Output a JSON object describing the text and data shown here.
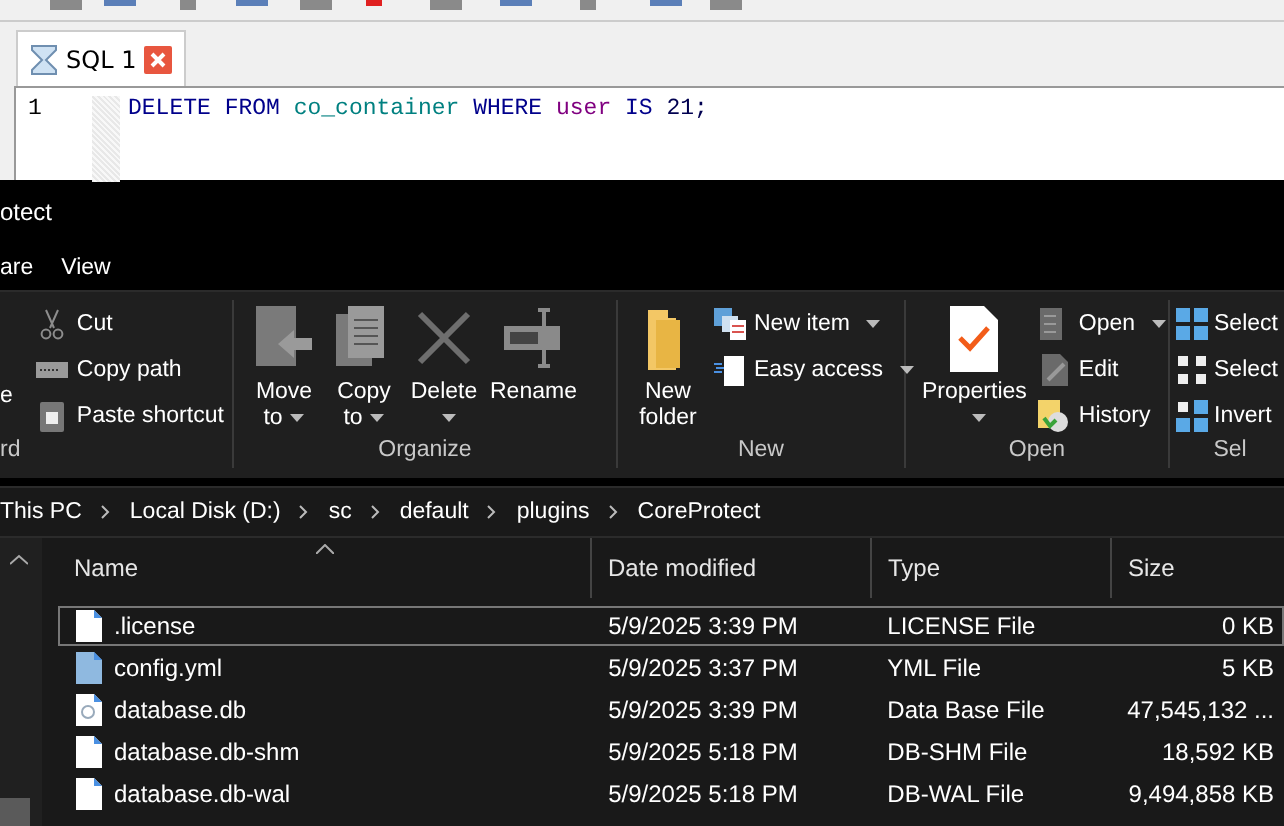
{
  "sql_editor": {
    "tab": {
      "title": "SQL 1",
      "selected": true
    },
    "lines": [
      {
        "number": "1",
        "tokens": [
          {
            "text": "DELETE",
            "kind": "keyword"
          },
          {
            "text": "FROM",
            "kind": "keyword"
          },
          {
            "text": "co_container",
            "kind": "table"
          },
          {
            "text": "WHERE",
            "kind": "keyword"
          },
          {
            "text": "user",
            "kind": "column"
          },
          {
            "text": "IS",
            "kind": "keyword"
          },
          {
            "text": "21;",
            "kind": "plain"
          }
        ]
      }
    ]
  },
  "explorer": {
    "title": "otect",
    "menu_tabs": [
      {
        "label": "are",
        "selected": false
      },
      {
        "label": "View",
        "selected": false
      }
    ],
    "ribbon": [
      {
        "label": "rd",
        "items": [
          {
            "kind": "fragment",
            "label": "e"
          },
          {
            "kind": "small",
            "label": "Cut"
          },
          {
            "kind": "small",
            "label": "Copy path"
          },
          {
            "kind": "small",
            "label": "Paste shortcut"
          }
        ]
      },
      {
        "label": "Organize",
        "items": [
          {
            "kind": "large",
            "label": "Move to",
            "dropdown": true
          },
          {
            "kind": "large",
            "label": "Copy to",
            "dropdown": true
          },
          {
            "kind": "large",
            "label": "Delete",
            "dropdown": true
          },
          {
            "kind": "large",
            "label": "Rename",
            "dropdown": false
          }
        ]
      },
      {
        "label": "New",
        "items": [
          {
            "kind": "large",
            "label": "New folder",
            "dropdown": false
          },
          {
            "kind": "small",
            "label": "New item",
            "dropdown": true
          },
          {
            "kind": "small",
            "label": "Easy access",
            "dropdown": true
          }
        ]
      },
      {
        "label": "Open",
        "items": [
          {
            "kind": "large",
            "label": "Properties",
            "dropdown": true
          },
          {
            "kind": "small",
            "label": "Open",
            "dropdown": true
          },
          {
            "kind": "small",
            "label": "Edit",
            "dropdown": false
          },
          {
            "kind": "small",
            "label": "History",
            "dropdown": false
          }
        ]
      },
      {
        "label": "Sel",
        "items": [
          {
            "kind": "small",
            "label": "Select"
          },
          {
            "kind": "small",
            "label": "Select"
          },
          {
            "kind": "small",
            "label": "Invert"
          }
        ]
      }
    ],
    "breadcrumb": [
      "This PC",
      "Local Disk (D:)",
      "sc",
      "default",
      "plugins",
      "CoreProtect"
    ],
    "columns": [
      {
        "label": "Name",
        "sorted": true
      },
      {
        "label": "Date modified",
        "sorted": false
      },
      {
        "label": "Type",
        "sorted": false
      },
      {
        "label": "Size",
        "sorted": false
      }
    ],
    "rows": [
      {
        "name": ".license",
        "date": "5/9/2025 3:39 PM",
        "type": "LICENSE File",
        "size": "0 KB",
        "focused": true
      },
      {
        "name": "config.yml",
        "date": "5/9/2025 3:37 PM",
        "type": "YML File",
        "size": "5 KB",
        "focused": false
      },
      {
        "name": "database.db",
        "date": "5/9/2025 3:39 PM",
        "type": "Data Base File",
        "size": "47,545,132 ...",
        "focused": false
      },
      {
        "name": "database.db-shm",
        "date": "5/9/2025 5:18 PM",
        "type": "DB-SHM File",
        "size": "18,592 KB",
        "focused": false
      },
      {
        "name": "database.db-wal",
        "date": "5/9/2025 5:18 PM",
        "type": "DB-WAL File",
        "size": "9,494,858 KB",
        "focused": false
      }
    ]
  }
}
